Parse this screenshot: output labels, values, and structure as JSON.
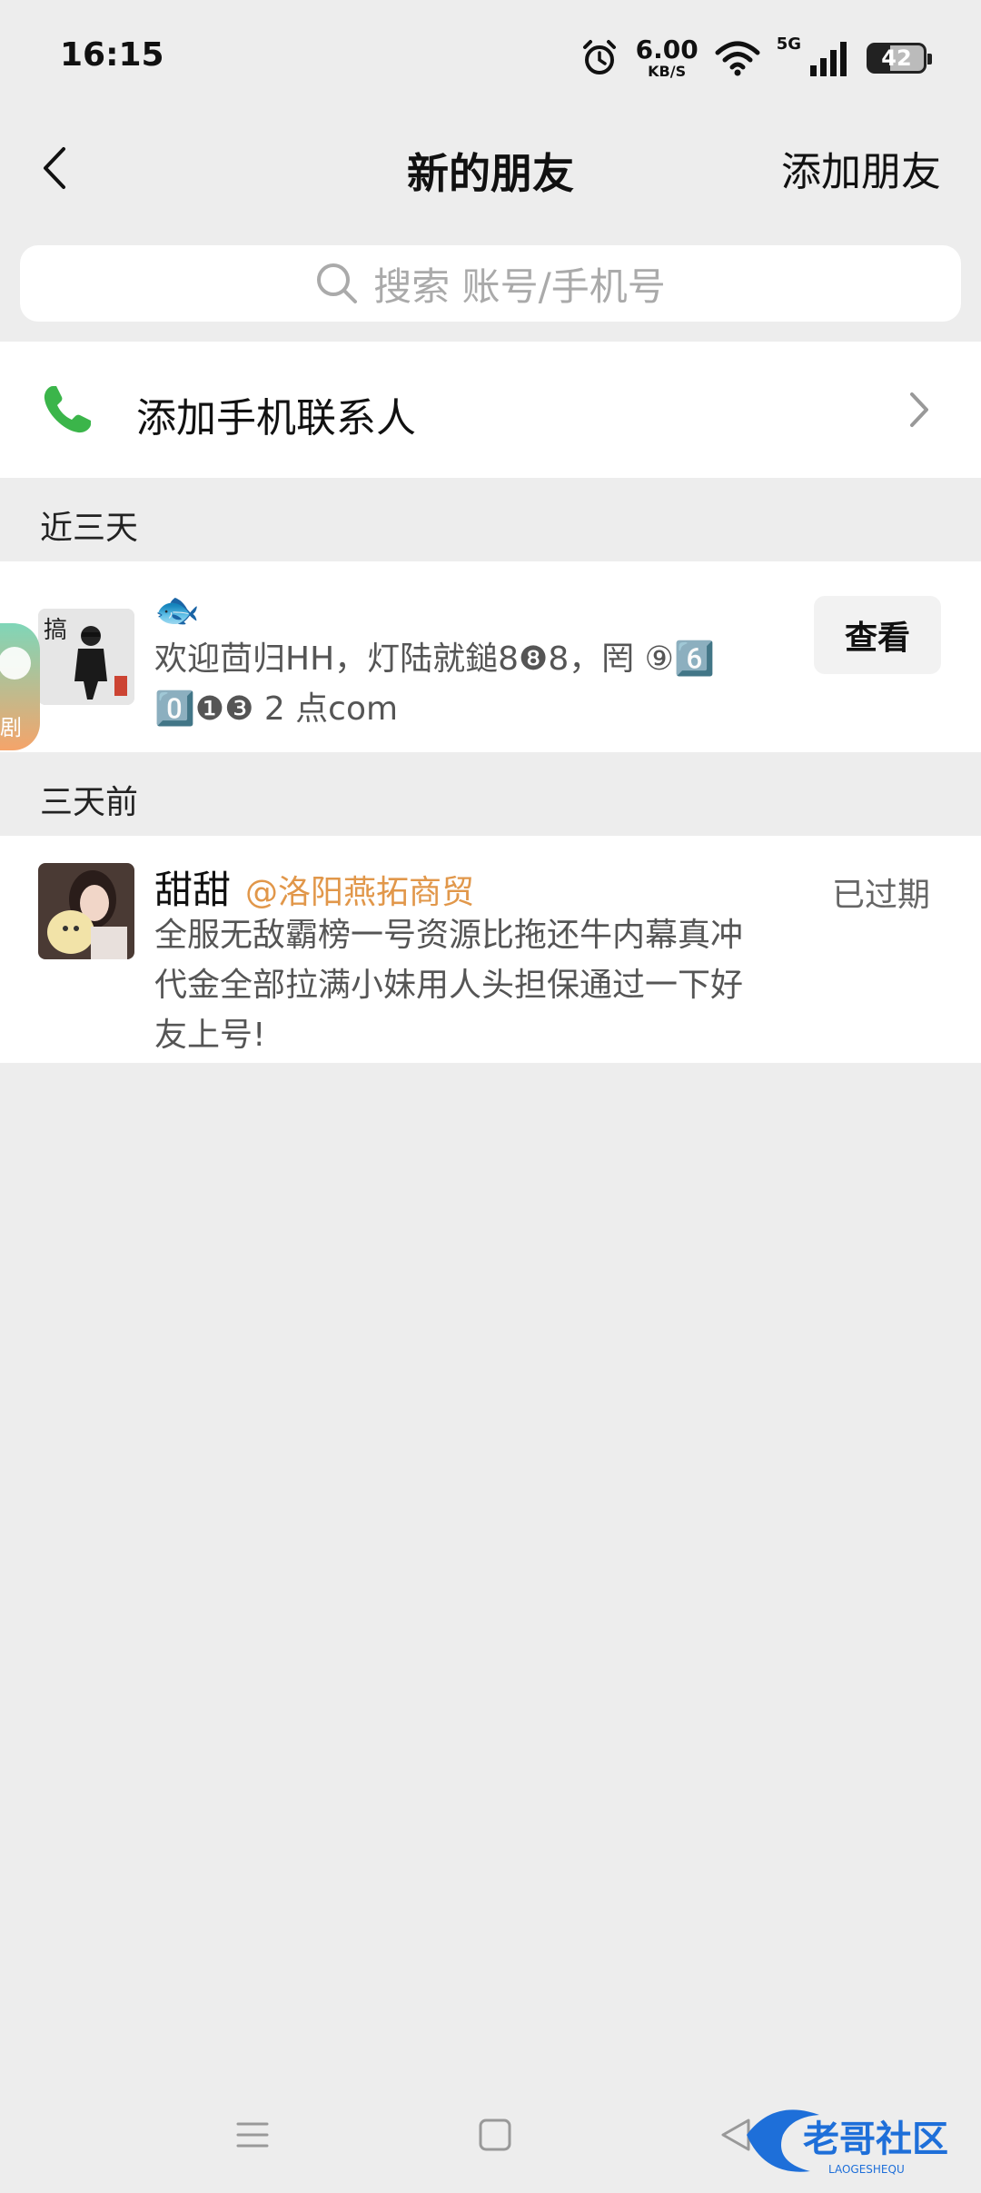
{
  "status_bar": {
    "time": "16:15",
    "net_speed": "6.00",
    "net_speed_unit": "KB/S",
    "network": "5G",
    "battery": "42"
  },
  "nav": {
    "title": "新的朋友",
    "action_label": "添加朋友"
  },
  "search": {
    "placeholder": "搜索 账号/手机号"
  },
  "phone_contacts": {
    "label": "添加手机联系人"
  },
  "sections": [
    {
      "title": "近三天",
      "items": [
        {
          "name": "🐟",
          "message_line1": "欢迎茴归HH，灯陆就鎚8❽8，罔 ⑨6️⃣",
          "message_line2": "0️⃣❶❸ 2 点com",
          "button_label": "查看",
          "avatar_text": "搞"
        }
      ]
    },
    {
      "title": "三天前",
      "items": [
        {
          "name": "甜甜",
          "source": "@洛阳燕拓商贸",
          "message": "全服无敌霸榜一号资源比拖还牛内幕真冲代金全部拉满小妹用人头担保通过一下好友上号!",
          "status": "已过期"
        }
      ]
    }
  ],
  "floating_bubble": {
    "text": "剧"
  },
  "watermark": {
    "text": "老哥社区",
    "sub": "LAOGESHEQU"
  },
  "colors": {
    "background": "#ededed",
    "accent_green": "#3bb54a",
    "source_orange": "#e1974a"
  },
  "icons": [
    "back-arrow-icon",
    "search-icon",
    "phone-icon",
    "chevron-right-icon",
    "alarm-icon",
    "wifi-icon",
    "signal-icon",
    "battery-icon",
    "menu-icon",
    "home-icon",
    "back-nav-icon"
  ]
}
